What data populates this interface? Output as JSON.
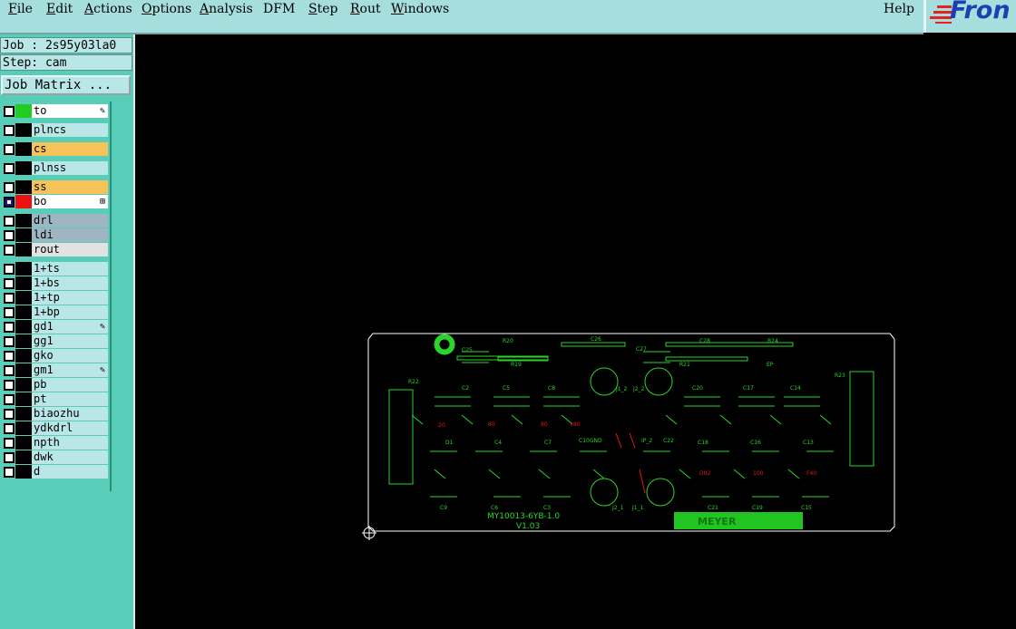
{
  "menubar": {
    "items": [
      {
        "id": "file",
        "label": "File",
        "u": "F",
        "rest": "ile"
      },
      {
        "id": "edit",
        "label": "Edit",
        "u": "E",
        "rest": "dit"
      },
      {
        "id": "actions",
        "label": "Actions",
        "u": "A",
        "rest": "ctions"
      },
      {
        "id": "options",
        "label": "Options",
        "u": "O",
        "rest": "ptions"
      },
      {
        "id": "analysis",
        "label": "Analysis",
        "u": "A",
        "rest": "nalysis"
      },
      {
        "id": "dfm",
        "label": "DFM",
        "u": "",
        "rest": "DFM"
      },
      {
        "id": "step",
        "label": "Step",
        "u": "S",
        "rest": "tep"
      },
      {
        "id": "rout",
        "label": "Rout",
        "u": "R",
        "rest": "out"
      },
      {
        "id": "windows",
        "label": "Windows",
        "u": "W",
        "rest": "indows"
      }
    ],
    "help_label": "Help"
  },
  "brand": {
    "logo_text": "Fron",
    "accent": "#1e3fb0",
    "stripe_color": "#e52222"
  },
  "job": {
    "job_line": "Job : 2s95y03la0",
    "step_line": "Step: cam",
    "matrix_button": "Job Matrix ..."
  },
  "layers": [
    {
      "name": "to",
      "color": "#22cc22",
      "bg": "#ffffff",
      "checked": false,
      "mark": "✎"
    },
    {
      "name": "plncs",
      "color": "#000000",
      "bg": "#b9e7e7",
      "checked": false,
      "mark": ""
    },
    {
      "name": "cs",
      "color": "#000000",
      "bg": "#f6c25a",
      "checked": false,
      "mark": ""
    },
    {
      "name": "plnss",
      "color": "#000000",
      "bg": "#b9e7e7",
      "checked": false,
      "mark": ""
    },
    {
      "name": "ss",
      "color": "#000000",
      "bg": "#f6c25a",
      "checked": false,
      "mark": ""
    },
    {
      "name": "bo",
      "color": "#ee1111",
      "bg": "#ffffff",
      "checked": true,
      "mark": "⊞"
    },
    {
      "name": "drl",
      "color": "#000000",
      "bg": "#9fb6c2",
      "checked": false,
      "mark": ""
    },
    {
      "name": "ldi",
      "color": "#000000",
      "bg": "#9fb6c2",
      "checked": false,
      "mark": ""
    },
    {
      "name": "rout",
      "color": "#000000",
      "bg": "#e2e2e2",
      "checked": false,
      "mark": ""
    },
    {
      "name": "1+ts",
      "color": "#000000",
      "bg": "#b9e7e7",
      "checked": false,
      "mark": ""
    },
    {
      "name": "1+bs",
      "color": "#000000",
      "bg": "#b9e7e7",
      "checked": false,
      "mark": ""
    },
    {
      "name": "1+tp",
      "color": "#000000",
      "bg": "#b9e7e7",
      "checked": false,
      "mark": ""
    },
    {
      "name": "1+bp",
      "color": "#000000",
      "bg": "#b9e7e7",
      "checked": false,
      "mark": ""
    },
    {
      "name": "gd1",
      "color": "#000000",
      "bg": "#b9e7e7",
      "checked": false,
      "mark": "✎"
    },
    {
      "name": "gg1",
      "color": "#000000",
      "bg": "#b9e7e7",
      "checked": false,
      "mark": ""
    },
    {
      "name": "gko",
      "color": "#000000",
      "bg": "#b9e7e7",
      "checked": false,
      "mark": ""
    },
    {
      "name": "gm1",
      "color": "#000000",
      "bg": "#b9e7e7",
      "checked": false,
      "mark": "✎"
    },
    {
      "name": "pb",
      "color": "#000000",
      "bg": "#b9e7e7",
      "checked": false,
      "mark": ""
    },
    {
      "name": "pt",
      "color": "#000000",
      "bg": "#b9e7e7",
      "checked": false,
      "mark": ""
    },
    {
      "name": "biaozhu",
      "color": "#000000",
      "bg": "#b9e7e7",
      "checked": false,
      "mark": ""
    },
    {
      "name": "ydkdrl",
      "color": "#000000",
      "bg": "#b9e7e7",
      "checked": false,
      "mark": ""
    },
    {
      "name": "npth",
      "color": "#000000",
      "bg": "#b9e7e7",
      "checked": false,
      "mark": ""
    },
    {
      "name": "dwk",
      "color": "#000000",
      "bg": "#b9e7e7",
      "checked": false,
      "mark": ""
    },
    {
      "name": "d",
      "color": "#000000",
      "bg": "#b9e7e7",
      "checked": false,
      "mark": ""
    }
  ],
  "board": {
    "silk_labels": [
      "C25",
      "R20",
      "C26",
      "C27",
      "C28",
      "R24",
      "R19",
      "R21",
      "EP",
      "R22",
      "R23",
      "C2",
      "C5",
      "C8",
      "C20",
      "C17",
      "C14",
      "D1",
      "C4",
      "C7",
      "C10GND",
      "IP_2",
      "C22",
      "C18",
      "C16",
      "C13",
      "C9",
      "C6",
      "C3",
      "J2_1",
      "J1_1",
      "C21",
      "C19",
      "C15",
      "J1_2",
      "J2_2"
    ],
    "red_labels": [
      "20",
      "80",
      "80",
      "180",
      "D02",
      "100",
      "F40"
    ],
    "board_text_1": "MY10013-6YB-1.0",
    "board_text_2": "V1.03",
    "logo_text": "MEYER",
    "silk_color": "#2ad52a",
    "outline_color": "#ffffff",
    "red_color": "#e51818"
  }
}
